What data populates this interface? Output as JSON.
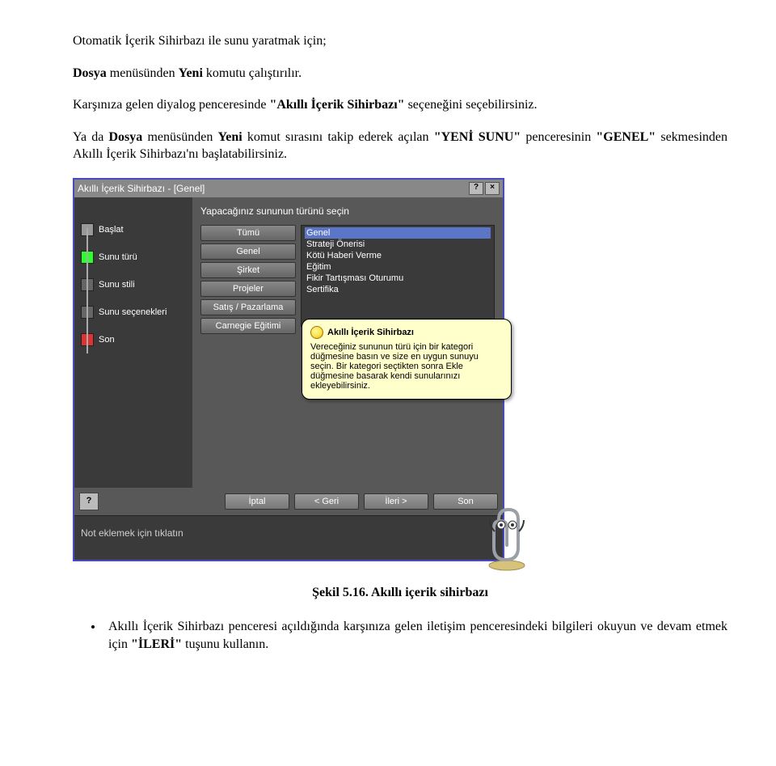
{
  "para1_pre": "Otomatik İçerik Sihirbazı ile sunu yaratmak için;",
  "para2_a": "Dosya",
  "para2_b": " menüsünden ",
  "para2_c": "Yeni",
  "para2_d": " komutu çalıştırılır.",
  "para3_a": "Karşınıza gelen diyalog penceresinde ",
  "para3_b": "\"Akıllı İçerik Sihirbazı\"",
  "para3_c": " seçeneğini seçebilirsiniz.",
  "para4_a": "Ya da ",
  "para4_b": "Dosya",
  "para4_c": " menüsünden ",
  "para4_d": "Yeni",
  "para4_e": " komut sırasını takip ederek açılan ",
  "para4_f": "\"YENİ SUNU\"",
  "para4_g": " penceresinin ",
  "para4_h": "\"GENEL\"",
  "para4_i": " sekmesinden Akıllı İçerik Sihirbazı'nı başlatabilirsiniz.",
  "dialog": {
    "title": "Akıllı İçerik Sihirbazı - [Genel]",
    "help": "?",
    "close": "×",
    "heading": "Yapacağınız sununun türünü seçin",
    "steps": [
      "Başlat",
      "Sunu türü",
      "Sunu stili",
      "Sunu seçenekleri",
      "Son"
    ],
    "categories": [
      "Tümü",
      "Genel",
      "Şirket",
      "Projeler",
      "Satış / Pazarlama",
      "Carnegie Eğitimi"
    ],
    "list": [
      "Genel",
      "Strateji Önerisi",
      "Kötü Haberi Verme",
      "Eğitim",
      "Fikir Tartışması Oturumu",
      "Sertifika"
    ],
    "tooltip_title": "Akıllı İçerik Sihirbazı",
    "tooltip_body": "Vereceğiniz sununun türü için bir kategori düğmesine basın ve size en uygun sunuyu seçin. Bir kategori seçtikten sonra Ekle düğmesine basarak kendi sunularınızı ekleyebilirsiniz.",
    "buttons": {
      "help": "?",
      "cancel": "İptal",
      "back": "< Geri",
      "next": "İleri >",
      "finish": "Son"
    },
    "notes_hint": "Not eklemek için tıklatın"
  },
  "caption": "Şekil 5.16. Akıllı içerik sihirbazı",
  "bullet_a": "Akıllı İçerik Sihirbazı penceresi açıldığında karşınıza gelen iletişim penceresindeki bilgileri okuyun ve devam etmek için ",
  "bullet_b": "\"İLERİ\"",
  "bullet_c": " tuşunu kullanın."
}
